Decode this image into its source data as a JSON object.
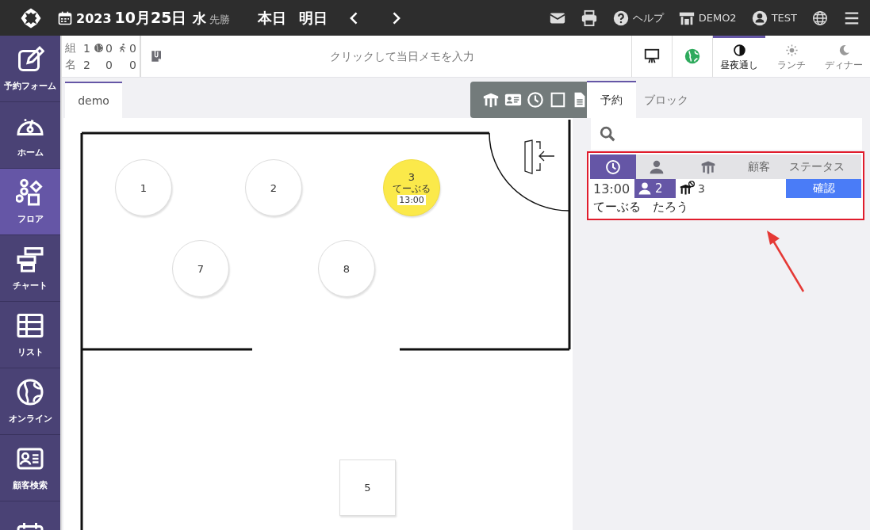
{
  "header": {
    "year": "2023",
    "date": "10月25日",
    "weekday": "水",
    "rokuyo": "先勝",
    "nav": [
      "本日",
      "明日"
    ],
    "help": "ヘルプ",
    "store": "DEMO2",
    "user": "TEST"
  },
  "sidebar": {
    "items": [
      {
        "kind": "form",
        "label": "予約フォーム",
        "selected": false
      },
      {
        "kind": "home",
        "label": "ホーム",
        "selected": false
      },
      {
        "kind": "floor",
        "label": "フロア",
        "selected": true
      },
      {
        "kind": "chart",
        "label": "チャート",
        "selected": false
      },
      {
        "kind": "list",
        "label": "リスト",
        "selected": false
      },
      {
        "kind": "online",
        "label": "オンライン",
        "selected": false
      },
      {
        "kind": "customer",
        "label": "顧客検索",
        "selected": false
      },
      {
        "kind": "calendar",
        "selected": false
      }
    ]
  },
  "stats": {
    "rows": [
      {
        "label": "組",
        "values": [
          "1",
          "0",
          "0"
        ]
      },
      {
        "label": "名",
        "values": [
          "2",
          "0",
          "0"
        ]
      }
    ]
  },
  "memo": {
    "placeholder": "クリックして当日メモを入力"
  },
  "shifts": [
    {
      "kind": "allday",
      "label": "昼夜通し",
      "selected": true
    },
    {
      "kind": "lunch",
      "label": "ランチ",
      "selected": false
    },
    {
      "kind": "dinner",
      "label": "ディナー",
      "selected": false
    }
  ],
  "floor_tabs": [
    {
      "label": "demo",
      "selected": true
    }
  ],
  "floor": {
    "tables": [
      {
        "number": "1",
        "kind": "round",
        "occupied": false
      },
      {
        "number": "2",
        "kind": "round",
        "occupied": false
      },
      {
        "number": "3",
        "kind": "round",
        "guest": "てーぶる",
        "time": "13:00",
        "occupied": true
      },
      {
        "number": "7",
        "kind": "round",
        "occupied": false
      },
      {
        "number": "8",
        "kind": "round",
        "occupied": false
      },
      {
        "number": "5",
        "kind": "square",
        "occupied": false
      }
    ]
  },
  "panel_tabs": [
    {
      "label": "予約",
      "selected": true
    },
    {
      "label": "ブロック",
      "selected": false
    }
  ],
  "reservations": {
    "columns": [
      {
        "kind": "time",
        "selected": true
      },
      {
        "kind": "guests",
        "selected": false
      },
      {
        "kind": "table",
        "selected": false
      },
      {
        "kind": "text",
        "label": "顧客",
        "selected": false
      },
      {
        "kind": "text",
        "label": "ステータス",
        "selected": false
      }
    ],
    "rows": [
      {
        "time": "13:00",
        "guests": "2",
        "table": "3",
        "status": "確認",
        "name": "てーぶる　たろう"
      }
    ]
  }
}
